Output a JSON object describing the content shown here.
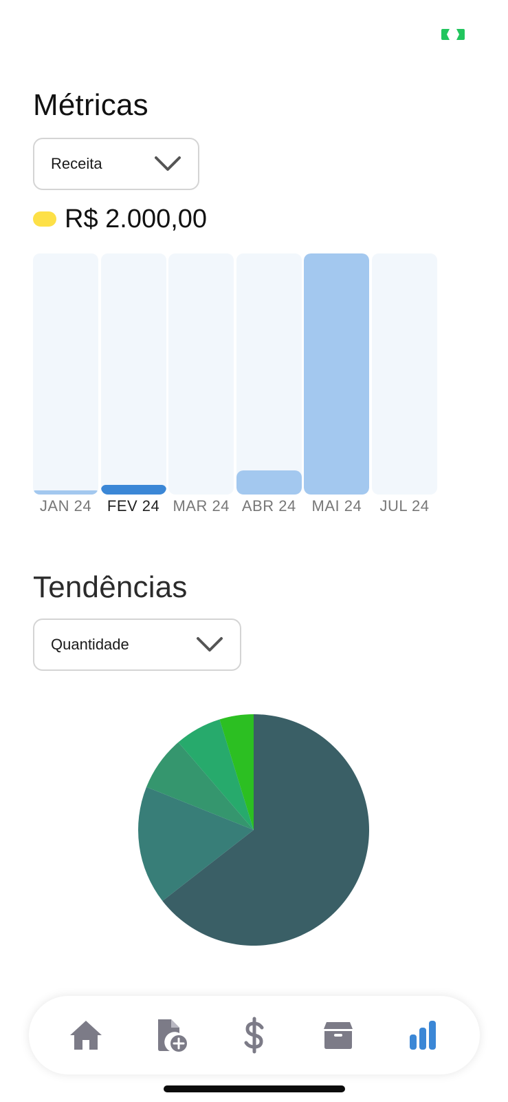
{
  "metrics": {
    "title": "Métricas",
    "selector_value": "Receita",
    "current_value": "R$ 2.000,00",
    "legend_color": "#fde047"
  },
  "chart_data": [
    {
      "type": "bar",
      "categories": [
        "JAN 24",
        "FEV 24",
        "MAR 24",
        "ABR 24",
        "MAI 24",
        "JUL 24"
      ],
      "values": [
        150,
        333,
        0,
        833,
        8333,
        0
      ],
      "selected": "FEV 24",
      "ylim": [
        0,
        8333
      ],
      "colors": {
        "bar": "#a3c8ef",
        "selected": "#3b87d6",
        "track": "#f2f7fc"
      }
    },
    {
      "type": "pie",
      "slices": [
        {
          "value": 65.0,
          "color": "#3a5f66"
        },
        {
          "value": 16.7,
          "color": "#387e78"
        },
        {
          "value": 7.7,
          "color": "#35966e"
        },
        {
          "value": 6.6,
          "color": "#27aa6c"
        },
        {
          "value": 4.8,
          "color": "#2cbf22"
        }
      ]
    }
  ],
  "trends": {
    "title": "Tendências",
    "selector_value": "Quantidade"
  },
  "tabbar": {
    "items": [
      {
        "icon": "home-icon",
        "active": false
      },
      {
        "icon": "file-plus-icon",
        "active": false
      },
      {
        "icon": "dollar-icon",
        "active": false
      },
      {
        "icon": "box-icon",
        "active": false
      },
      {
        "icon": "bar-chart-icon",
        "active": true
      }
    ],
    "active_color": "#3b87d6",
    "inactive_color": "#7c7b87"
  },
  "status": {
    "badge_icon": "camera-frame-icon",
    "badge_color": "#22c55e"
  }
}
